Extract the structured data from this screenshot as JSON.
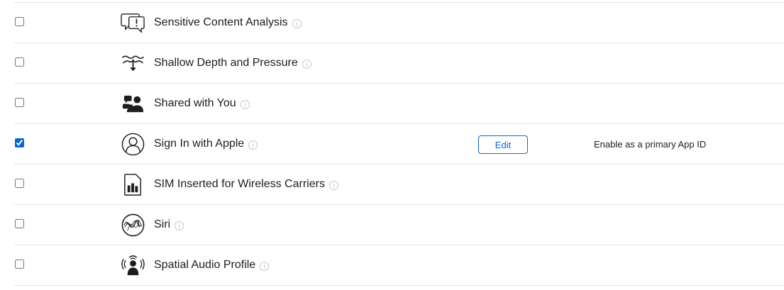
{
  "capabilities": [
    {
      "label": "Sensitive Content Analysis",
      "checked": false,
      "icon": "speech-bubble-alert-icon"
    },
    {
      "label": "Shallow Depth and Pressure",
      "checked": false,
      "icon": "depth-pressure-icon"
    },
    {
      "label": "Shared with You",
      "checked": false,
      "icon": "shared-people-icon"
    },
    {
      "label": "Sign In with Apple",
      "checked": true,
      "icon": "person-circle-icon",
      "edit_label": "Edit",
      "note": "Enable as a primary App ID"
    },
    {
      "label": "SIM Inserted for Wireless Carriers",
      "checked": false,
      "icon": "sim-card-icon"
    },
    {
      "label": "Siri",
      "checked": false,
      "icon": "siri-icon"
    },
    {
      "label": "Spatial Audio Profile",
      "checked": false,
      "icon": "spatial-audio-icon"
    }
  ],
  "colors": {
    "accent": "#0a66d8",
    "divider": "#e3e3e5",
    "text": "#1d1d1f",
    "info_icon": "#c6c6c8"
  }
}
